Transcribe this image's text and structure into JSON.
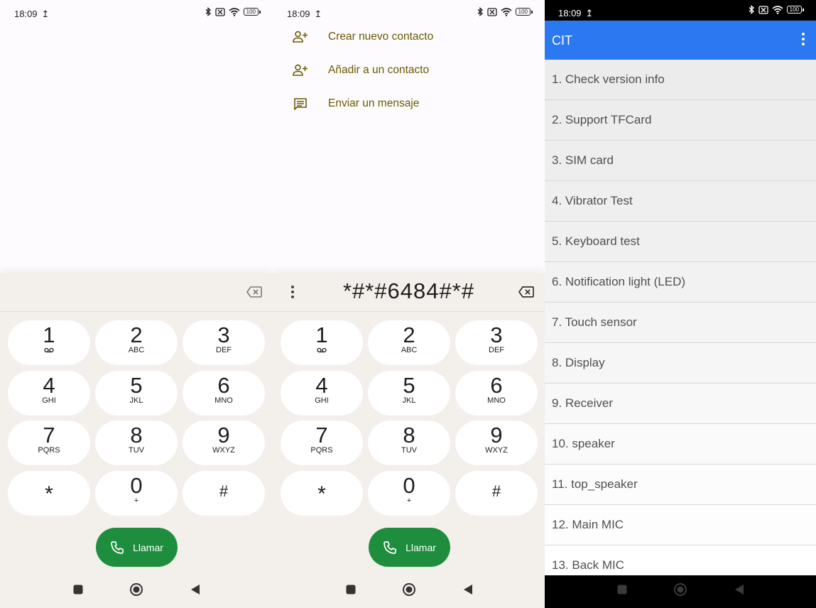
{
  "status": {
    "time": "18:09",
    "battery": "100"
  },
  "dialer_empty": {
    "digits": ""
  },
  "dialer_filled": {
    "digits": "*#*#6484#*#"
  },
  "suggestions": [
    {
      "label": "Crear nuevo contacto",
      "icon": "person-add-icon"
    },
    {
      "label": "Añadir a un contacto",
      "icon": "person-add-icon"
    },
    {
      "label": "Enviar un mensaje",
      "icon": "message-icon"
    }
  ],
  "keys": [
    {
      "num": "1",
      "letters": "",
      "icon": "voicemail-icon"
    },
    {
      "num": "2",
      "letters": "ABC"
    },
    {
      "num": "3",
      "letters": "DEF"
    },
    {
      "num": "4",
      "letters": "GHI"
    },
    {
      "num": "5",
      "letters": "JKL"
    },
    {
      "num": "6",
      "letters": "MNO"
    },
    {
      "num": "7",
      "letters": "PQRS"
    },
    {
      "num": "8",
      "letters": "TUV"
    },
    {
      "num": "9",
      "letters": "WXYZ"
    },
    {
      "num": "*",
      "letters": ""
    },
    {
      "num": "0",
      "letters": "+"
    },
    {
      "num": "#",
      "letters": ""
    }
  ],
  "call_label": "Llamar",
  "cit": {
    "title": "CIT",
    "items": [
      "1. Check version info",
      "2. Support TFCard",
      "3. SIM card",
      "4. Vibrator Test",
      "5. Keyboard test",
      "6. Notification light (LED)",
      "7. Touch sensor",
      "8. Display",
      "9. Receiver",
      "10. speaker",
      "11. top_speaker",
      "12. Main MIC",
      "13. Back MIC"
    ]
  },
  "colors": {
    "accent_green": "#1e8e3e",
    "cit_blue": "#2b78f0",
    "suggestion_text": "#6a5a00",
    "dialpad_bg": "#f3efea"
  }
}
